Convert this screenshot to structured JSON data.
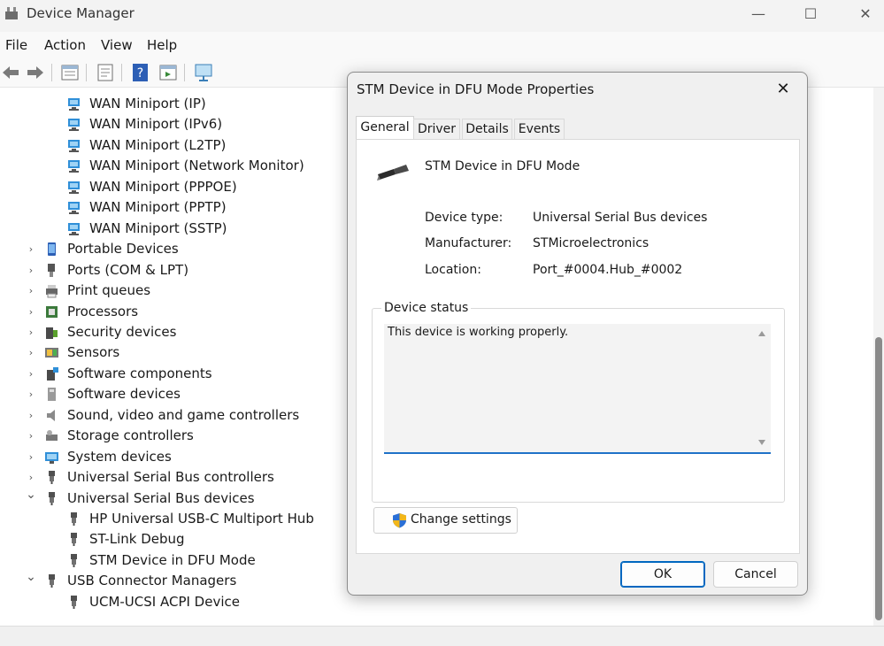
{
  "window": {
    "title": "Device Manager",
    "minimize_glyph": "—",
    "maximize_glyph": "☐",
    "close_glyph": "✕"
  },
  "menu": [
    "File",
    "Action",
    "View",
    "Help"
  ],
  "toolbar": {
    "buttons": [
      "back-arrow-icon",
      "forward-arrow-icon",
      "properties-icon",
      "update-driver-icon",
      "help-icon",
      "show-hidden-icon",
      "scan-hardware-icon"
    ]
  },
  "tree": {
    "rows": [
      {
        "label": "WAN Miniport (IP)",
        "level": 2,
        "icon": "network-adapter-icon",
        "expander": ""
      },
      {
        "label": "WAN Miniport (IPv6)",
        "level": 2,
        "icon": "network-adapter-icon",
        "expander": ""
      },
      {
        "label": "WAN Miniport (L2TP)",
        "level": 2,
        "icon": "network-adapter-icon",
        "expander": ""
      },
      {
        "label": "WAN Miniport (Network Monitor)",
        "level": 2,
        "icon": "network-adapter-icon",
        "expander": ""
      },
      {
        "label": "WAN Miniport (PPPOE)",
        "level": 2,
        "icon": "network-adapter-icon",
        "expander": ""
      },
      {
        "label": "WAN Miniport (PPTP)",
        "level": 2,
        "icon": "network-adapter-icon",
        "expander": ""
      },
      {
        "label": "WAN Miniport (SSTP)",
        "level": 2,
        "icon": "network-adapter-icon",
        "expander": ""
      },
      {
        "label": "Portable Devices",
        "level": 1,
        "icon": "portable-device-icon",
        "expander": "collapsed"
      },
      {
        "label": "Ports (COM & LPT)",
        "level": 1,
        "icon": "port-icon",
        "expander": "collapsed"
      },
      {
        "label": "Print queues",
        "level": 1,
        "icon": "printer-icon",
        "expander": "collapsed"
      },
      {
        "label": "Processors",
        "level": 1,
        "icon": "processor-icon",
        "expander": "collapsed"
      },
      {
        "label": "Security devices",
        "level": 1,
        "icon": "security-device-icon",
        "expander": "collapsed"
      },
      {
        "label": "Sensors",
        "level": 1,
        "icon": "sensor-icon",
        "expander": "collapsed"
      },
      {
        "label": "Software components",
        "level": 1,
        "icon": "software-component-icon",
        "expander": "collapsed"
      },
      {
        "label": "Software devices",
        "level": 1,
        "icon": "software-device-icon",
        "expander": "collapsed"
      },
      {
        "label": "Sound, video and game controllers",
        "level": 1,
        "icon": "speaker-icon",
        "expander": "collapsed"
      },
      {
        "label": "Storage controllers",
        "level": 1,
        "icon": "storage-controller-icon",
        "expander": "collapsed"
      },
      {
        "label": "System devices",
        "level": 1,
        "icon": "system-device-icon",
        "expander": "collapsed"
      },
      {
        "label": "Universal Serial Bus controllers",
        "level": 1,
        "icon": "usb-icon",
        "expander": "collapsed"
      },
      {
        "label": "Universal Serial Bus devices",
        "level": 1,
        "icon": "usb-icon",
        "expander": "expanded"
      },
      {
        "label": "HP Universal USB-C Multiport Hub",
        "level": 2,
        "icon": "usb-icon",
        "expander": ""
      },
      {
        "label": "ST-Link Debug",
        "level": 2,
        "icon": "usb-icon",
        "expander": ""
      },
      {
        "label": "STM Device in DFU Mode",
        "level": 2,
        "icon": "usb-icon",
        "expander": ""
      },
      {
        "label": "USB Connector Managers",
        "level": 1,
        "icon": "usb-icon",
        "expander": "expanded"
      },
      {
        "label": "UCM-UCSI ACPI Device",
        "level": 2,
        "icon": "usb-icon",
        "expander": ""
      }
    ]
  },
  "dialog": {
    "title": "STM Device in DFU Mode Properties",
    "close_glyph": "✕",
    "tabs": [
      {
        "label": "General",
        "active": true
      },
      {
        "label": "Driver",
        "active": false
      },
      {
        "label": "Details",
        "active": false
      },
      {
        "label": "Events",
        "active": false
      }
    ],
    "device_name": "STM Device in DFU Mode",
    "properties": [
      {
        "label": "Device type:",
        "value": "Universal Serial Bus devices"
      },
      {
        "label": "Manufacturer:",
        "value": "STMicroelectronics"
      },
      {
        "label": "Location:",
        "value": "Port_#0004.Hub_#0002"
      }
    ],
    "status_legend": "Device status",
    "status_text": "This device is working properly.",
    "change_settings_label": "Change settings",
    "ok_label": "OK",
    "cancel_label": "Cancel"
  },
  "colors": {
    "accent": "#0067c0",
    "focus_underline": "#1f72c8",
    "network_icon": "#2f8fd8",
    "usb_icon": "#505050"
  }
}
